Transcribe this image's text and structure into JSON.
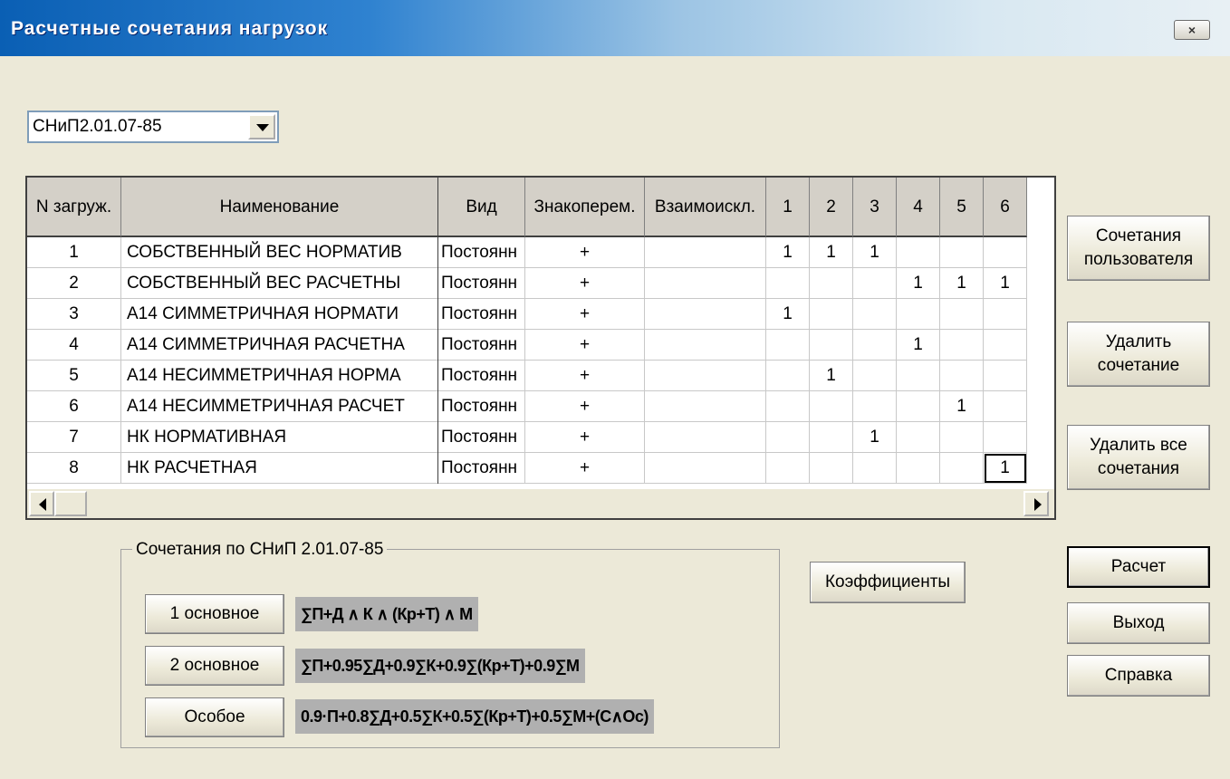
{
  "window": {
    "title": "Расчетные сочетания нагрузок",
    "close_label": "×"
  },
  "norm_select": {
    "value": "СНиП2.01.07-85"
  },
  "table": {
    "columns": [
      "N загруж.",
      "Наименование",
      "Вид",
      "Знакоперем.",
      "Взаимоискл.",
      "1",
      "2",
      "3",
      "4",
      "5",
      "6"
    ],
    "rows": [
      {
        "n": "1",
        "name": "СОБСТВЕННЫЙ ВЕС НОРМАТИВ",
        "vid": "Постоянн",
        "sign": "+",
        "excl": "",
        "c": [
          "1",
          "1",
          "1",
          "",
          "",
          ""
        ]
      },
      {
        "n": "2",
        "name": "СОБСТВЕННЫЙ ВЕС РАСЧЕТНЫ",
        "vid": "Постоянн",
        "sign": "+",
        "excl": "",
        "c": [
          "",
          "",
          "",
          "1",
          "1",
          "1"
        ]
      },
      {
        "n": "3",
        "name": "А14 СИММЕТРИЧНАЯ НОРМАТИ",
        "vid": "Постоянн",
        "sign": "+",
        "excl": "",
        "c": [
          "1",
          "",
          "",
          "",
          "",
          ""
        ]
      },
      {
        "n": "4",
        "name": "А14 СИММЕТРИЧНАЯ РАСЧЕТНА",
        "vid": "Постоянн",
        "sign": "+",
        "excl": "",
        "c": [
          "",
          "",
          "",
          "1",
          "",
          ""
        ]
      },
      {
        "n": "5",
        "name": "А14 НЕСИММЕТРИЧНАЯ НОРМА",
        "vid": "Постоянн",
        "sign": "+",
        "excl": "",
        "c": [
          "",
          "1",
          "",
          "",
          "",
          ""
        ]
      },
      {
        "n": "6",
        "name": "А14 НЕСИММЕТРИЧНАЯ РАСЧЕТ",
        "vid": "Постоянн",
        "sign": "+",
        "excl": "",
        "c": [
          "",
          "",
          "",
          "",
          "1",
          ""
        ]
      },
      {
        "n": "7",
        "name": "НК НОРМАТИВНАЯ",
        "vid": "Постоянн",
        "sign": "+",
        "excl": "",
        "c": [
          "",
          "",
          "1",
          "",
          "",
          ""
        ]
      },
      {
        "n": "8",
        "name": "НК РАСЧЕТНАЯ",
        "vid": "Постоянн",
        "sign": "+",
        "excl": "",
        "c": [
          "",
          "",
          "",
          "",
          "",
          "1"
        ]
      }
    ]
  },
  "right_buttons": {
    "user_combos": "Сочетания пользователя",
    "delete_combo": "Удалить сочетание",
    "delete_all": "Удалить все сочетания",
    "calc": "Расчет",
    "exit": "Выход",
    "help": "Справка"
  },
  "coeff_button": "Коэффициенты",
  "group": {
    "legend": "Сочетания по СНиП 2.01.07-85",
    "items": [
      {
        "label": "1 основное",
        "formula": "∑П+Д ∧ К ∧ (Кр+Т) ∧ М"
      },
      {
        "label": "2 основное",
        "formula": "∑П+0.95∑Д+0.9∑К+0.9∑(Кр+Т)+0.9∑М"
      },
      {
        "label": "Особое",
        "formula": "0.9·П+0.8∑Д+0.5∑К+0.5∑(Кр+Т)+0.5∑М+(С∧Ос)"
      }
    ]
  }
}
